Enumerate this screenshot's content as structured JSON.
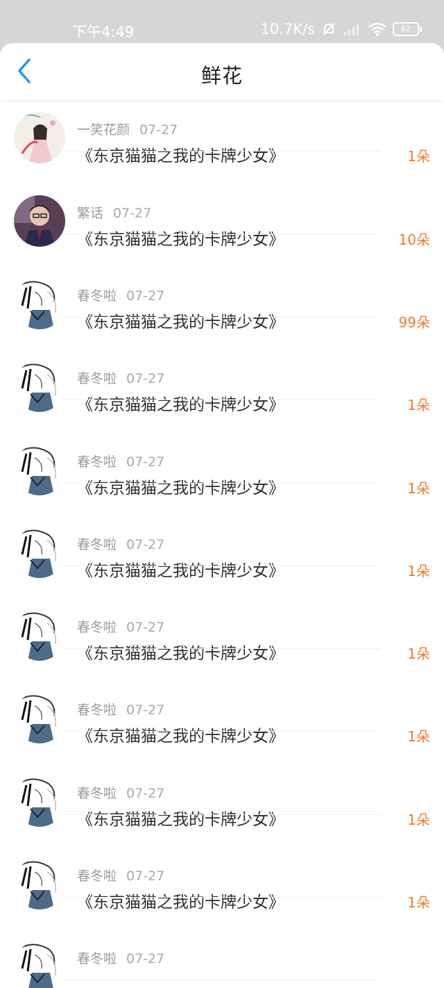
{
  "status_bar": {
    "time": "下午4:49",
    "network_speed": "10.7K/s",
    "battery": "62",
    "icons": [
      "mute-bell-icon",
      "signal-icon",
      "wifi-icon",
      "battery-icon"
    ]
  },
  "header": {
    "title": "鲜花",
    "back_icon": "chevron-left-icon"
  },
  "colors": {
    "accent": "#2196F3",
    "count": "#EE7A2C",
    "status_bar": "#D6D6D6"
  },
  "rows": [
    {
      "user": "",
      "date": "",
      "book": "《东京猫猫之我的卡牌少女》",
      "count": "1朵",
      "avatar": "anime-girl"
    },
    {
      "user": "一笑花颜",
      "date": "07-27",
      "book": "《东京猫猫之我的卡牌少女》",
      "count": "1朵",
      "avatar": "anime-girl"
    },
    {
      "user": "繁话",
      "date": "07-27",
      "book": "《东京猫猫之我的卡牌少女》",
      "count": "10朵",
      "avatar": "boy-photo"
    },
    {
      "user": "春冬啦",
      "date": "07-27",
      "book": "《东京猫猫之我的卡牌少女》",
      "count": "99朵",
      "avatar": "sketch"
    },
    {
      "user": "春冬啦",
      "date": "07-27",
      "book": "《东京猫猫之我的卡牌少女》",
      "count": "1朵",
      "avatar": "sketch"
    },
    {
      "user": "春冬啦",
      "date": "07-27",
      "book": "《东京猫猫之我的卡牌少女》",
      "count": "1朵",
      "avatar": "sketch"
    },
    {
      "user": "春冬啦",
      "date": "07-27",
      "book": "《东京猫猫之我的卡牌少女》",
      "count": "1朵",
      "avatar": "sketch"
    },
    {
      "user": "春冬啦",
      "date": "07-27",
      "book": "《东京猫猫之我的卡牌少女》",
      "count": "1朵",
      "avatar": "sketch"
    },
    {
      "user": "春冬啦",
      "date": "07-27",
      "book": "《东京猫猫之我的卡牌少女》",
      "count": "1朵",
      "avatar": "sketch"
    },
    {
      "user": "春冬啦",
      "date": "07-27",
      "book": "《东京猫猫之我的卡牌少女》",
      "count": "1朵",
      "avatar": "sketch"
    },
    {
      "user": "春冬啦",
      "date": "07-27",
      "book": "《东京猫猫之我的卡牌少女》",
      "count": "1朵",
      "avatar": "sketch"
    },
    {
      "user": "春冬啦",
      "date": "07-27",
      "book": "",
      "count": "",
      "avatar": "sketch"
    }
  ]
}
